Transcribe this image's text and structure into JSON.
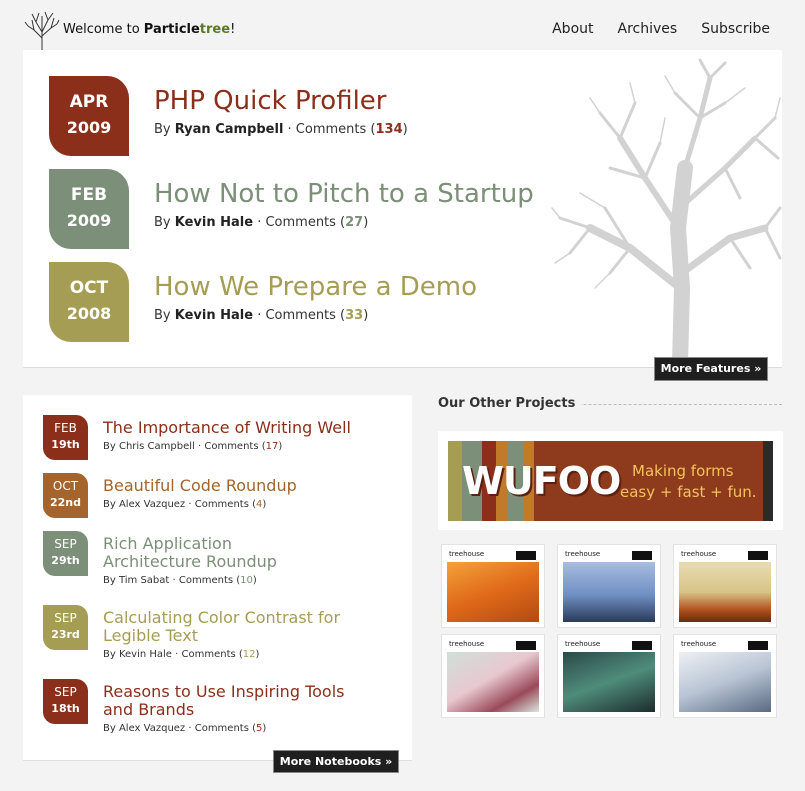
{
  "header": {
    "welcome_prefix": "Welcome to ",
    "brand_part1": "Particle",
    "brand_part2": "tree",
    "brand_suffix": "!",
    "nav": [
      "About",
      "Archives",
      "Subscribe"
    ]
  },
  "featured": [
    {
      "month": "APR",
      "year": "2009",
      "title": "PHP Quick Profiler",
      "by": "By ",
      "author": "Ryan Campbell",
      "comments_label": " · Comments (",
      "comments": "134",
      "close": ")",
      "color": "#8b2f1b"
    },
    {
      "month": "FEB",
      "year": "2009",
      "title": "How Not to Pitch to a Startup",
      "by": "By ",
      "author": "Kevin Hale",
      "comments_label": " · Comments (",
      "comments": "27",
      "close": ")",
      "color": "#7c8f78"
    },
    {
      "month": "OCT",
      "year": "2008",
      "title": "How We Prepare a Demo",
      "by": "By ",
      "author": "Kevin Hale",
      "comments_label": " · Comments (",
      "comments": "33",
      "close": ")",
      "color": "#a69d54"
    }
  ],
  "more_features_label": "More Features »",
  "notebooks": [
    {
      "month": "FEB",
      "day": "19th",
      "title": "The Importance of Writing Well",
      "author_line": "By Chris Campbell · Comments (",
      "comments": "17",
      "close": ")",
      "color": "#8b2f1b"
    },
    {
      "month": "OCT",
      "day": "22nd",
      "title": "Beautiful Code Roundup",
      "author_line": "By Alex Vazquez · Comments (",
      "comments": "4",
      "close": ")",
      "color": "#a4642b"
    },
    {
      "month": "SEP",
      "day": "29th",
      "title": "Rich Application Architecture Roundup",
      "author_line": "By Tim Sabat · Comments (",
      "comments": "10",
      "close": ")",
      "color": "#7c8f78"
    },
    {
      "month": "SEP",
      "day": "23rd",
      "title": "Calculating Color Contrast for Legible Text",
      "author_line": "By Kevin Hale · Comments (",
      "comments": "12",
      "close": ")",
      "color": "#a69d54"
    },
    {
      "month": "SEP",
      "day": "18th",
      "title": "Reasons to Use Inspiring Tools and Brands",
      "author_line": "By Alex Vazquez · Comments (",
      "comments": "5",
      "close": ")",
      "color": "#8b2f1b"
    }
  ],
  "more_notebooks_label": "More Notebooks »",
  "projects": {
    "heading": "Our Other Projects",
    "wufoo_logo": "WUFOO",
    "wufoo_tagline1": "Making forms",
    "wufoo_tagline2": "easy + fast + fun.",
    "thumb_label": "treehouse"
  }
}
